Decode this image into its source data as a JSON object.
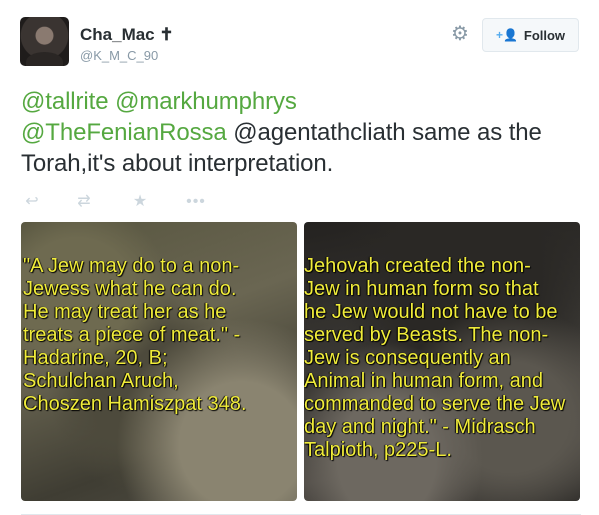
{
  "user": {
    "display_name": "Cha_Mac ✝",
    "screen_name": "@K_M_C_90"
  },
  "header": {
    "settings_icon": "gear-icon",
    "follow_label": "Follow",
    "follow_icon": "add-person-icon"
  },
  "tweet": {
    "mentions": [
      "@tallrite",
      "@markhumphrys",
      "@TheFenianRossa",
      "@agentathcliath"
    ],
    "text_after_mentions": "same as the Torah,it's about interpretation."
  },
  "actions": [
    {
      "icon": "reply-icon"
    },
    {
      "icon": "retweet-icon"
    },
    {
      "icon": "favorite-icon"
    },
    {
      "icon": "more-icon"
    }
  ],
  "media": [
    {
      "caption": "\"A Jew may do to a non-\nJewess what he can do.\nHe may treat her as he\ntreats a piece of meat.\" -\nHadarine, 20, B;\nSchulchan Aruch,\nChoszen Hamiszpat 348."
    },
    {
      "caption": "Jehovah created the non-\nJew in human form so that\nhe Jew would not have to be\nserved by Beasts. The non-\nJew is consequently an\nAnimal in human form, and\ncommanded to serve the Jew\nday and night.\" - Midrasch\nTalpioth, p225-L."
    }
  ],
  "colors": {
    "mention": "#55a840",
    "caption_text": "#f0ec3a",
    "follow_icon": "#55acee"
  }
}
